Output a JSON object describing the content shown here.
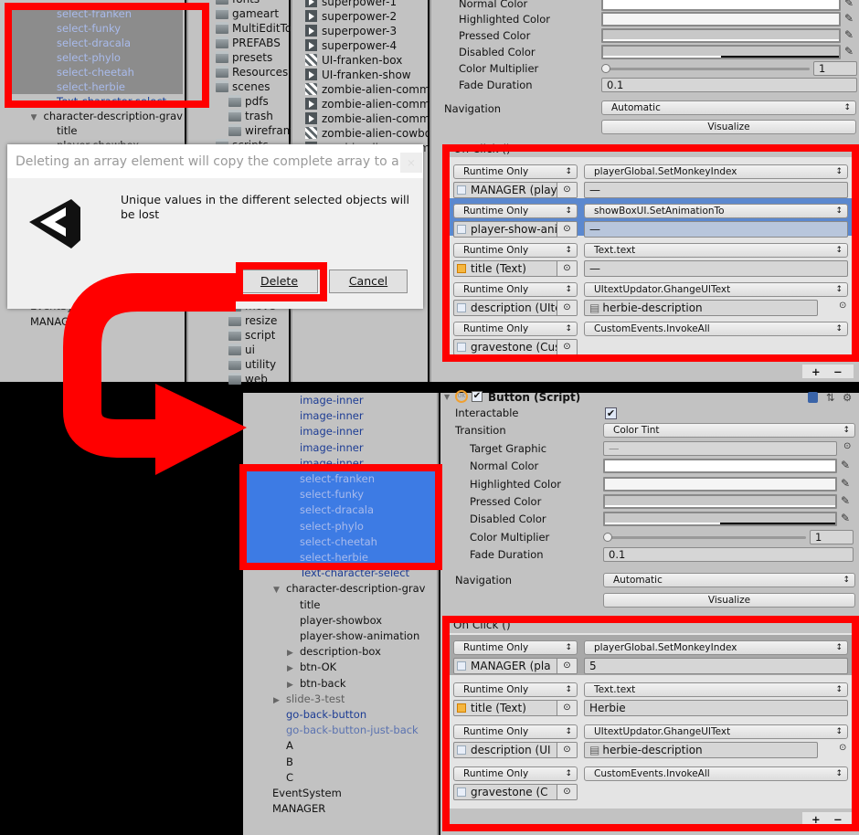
{
  "top": {
    "hierarchy": {
      "items": [
        {
          "label": "select-franken",
          "depth": 2,
          "style": "prefab-sel"
        },
        {
          "label": "select-funky",
          "depth": 2,
          "style": "prefab-sel"
        },
        {
          "label": "select-dracala",
          "depth": 2,
          "style": "prefab-sel"
        },
        {
          "label": "select-phylo",
          "depth": 2,
          "style": "prefab-sel"
        },
        {
          "label": "select-cheetah",
          "depth": 2,
          "style": "prefab-sel"
        },
        {
          "label": "select-herbie",
          "depth": 2,
          "style": "prefab-sel"
        },
        {
          "label": "Text-character-select",
          "depth": 2,
          "style": "prefab"
        },
        {
          "label": "character-description-grav",
          "depth": 1,
          "style": "",
          "arrow": "down"
        },
        {
          "label": "title",
          "depth": 2,
          "style": ""
        },
        {
          "label": "player-showbox",
          "depth": 2,
          "style": ""
        }
      ],
      "after_dialog": [
        {
          "label": "EventSystem",
          "depth": 0,
          "style": ""
        },
        {
          "label": "MANAGER",
          "depth": 0,
          "style": ""
        }
      ]
    },
    "folders": [
      {
        "label": "fonts",
        "indent": 0
      },
      {
        "label": "gameart",
        "indent": 0,
        "arrow": "right"
      },
      {
        "label": "MultiEditTo",
        "indent": 0,
        "arrow": "right"
      },
      {
        "label": "PREFABS",
        "indent": 0,
        "arrow": "right"
      },
      {
        "label": "presets",
        "indent": 0
      },
      {
        "label": "Resources",
        "indent": 0
      },
      {
        "label": "scenes",
        "indent": 0,
        "arrow": "down"
      },
      {
        "label": "pdfs",
        "indent": 1
      },
      {
        "label": "trash",
        "indent": 1
      },
      {
        "label": "wirefram",
        "indent": 1
      },
      {
        "label": "scripts",
        "indent": 0,
        "arrow": "down"
      }
    ],
    "folders_lower": [
      {
        "label": "move",
        "indent": 1
      },
      {
        "label": "resize",
        "indent": 1
      },
      {
        "label": "script",
        "indent": 1
      },
      {
        "label": "ui",
        "indent": 1
      },
      {
        "label": "utility",
        "indent": 1
      },
      {
        "label": "web",
        "indent": 1
      }
    ],
    "files": [
      {
        "label": "superpower-1",
        "icon": "play"
      },
      {
        "label": "superpower-2",
        "icon": "play"
      },
      {
        "label": "superpower-3",
        "icon": "play"
      },
      {
        "label": "superpower-4",
        "icon": "play"
      },
      {
        "label": "UI-franken-box",
        "icon": "grid"
      },
      {
        "label": "UI-franken-show",
        "icon": "play"
      },
      {
        "label": "zombie-alien-comma",
        "icon": "grid"
      },
      {
        "label": "zombie-alien-comma",
        "icon": "play"
      },
      {
        "label": "zombie-alien-comma",
        "icon": "play"
      },
      {
        "label": "zombie-alien-cowbo",
        "icon": "grid"
      },
      {
        "label": "zombie-alien-comma",
        "icon": "play"
      }
    ],
    "inspector": {
      "normal_color": "Normal Color",
      "highlighted_color": "Highlighted Color",
      "pressed_color": "Pressed Color",
      "disabled_color": "Disabled Color",
      "color_multiplier": "Color Multiplier",
      "color_multiplier_value": "1",
      "fade_duration": "Fade Duration",
      "fade_duration_value": "0.1",
      "navigation": "Navigation",
      "navigation_value": "Automatic",
      "visualize": "Visualize",
      "on_click": "On Click ()",
      "entries": [
        {
          "mode": "Runtime Only",
          "function": "playerGlobal.SetMonkeyIndex",
          "object": "MANAGER (playe",
          "obj_icon": "script",
          "arg": "—"
        },
        {
          "mode": "Runtime Only",
          "function": "showBoxUI.SetAnimationTo",
          "object": "player-show-anim",
          "obj_icon": "script",
          "arg": "—",
          "selected": true
        },
        {
          "mode": "Runtime Only",
          "function": "Text.text",
          "object": "title (Text)",
          "obj_icon": "text",
          "arg": "—"
        },
        {
          "mode": "Runtime Only",
          "function": "UItextUpdator.GhangeUIText",
          "object": "description (UIte",
          "obj_icon": "script",
          "arg": "herbie-description",
          "arg_is_object": true
        },
        {
          "mode": "Runtime Only",
          "function": "CustomEvents.InvokeAll",
          "object": "gravestone (Cus",
          "obj_icon": "script"
        }
      ],
      "plus": "+",
      "minus": "−"
    },
    "dialog": {
      "title": "Deleting an array element will copy the complete array to all ...",
      "close": "×",
      "message": "Unique values in the different selected objects will be lost",
      "delete": "Delete",
      "cancel": "Cancel"
    }
  },
  "bottom": {
    "hierarchy": {
      "items": [
        {
          "label": "image-inner",
          "depth": 2,
          "style": "prefab"
        },
        {
          "label": "image-inner",
          "depth": 2,
          "style": "prefab"
        },
        {
          "label": "image-inner",
          "depth": 2,
          "style": "prefab"
        },
        {
          "label": "image-inner",
          "depth": 2,
          "style": "prefab"
        },
        {
          "label": "image-inner",
          "depth": 2,
          "style": "prefab"
        },
        {
          "label": "select-franken",
          "depth": 2,
          "style": "prefab-sel",
          "selected": true
        },
        {
          "label": "select-funky",
          "depth": 2,
          "style": "prefab-sel",
          "selected": true
        },
        {
          "label": "select-dracala",
          "depth": 2,
          "style": "prefab-sel",
          "selected": true
        },
        {
          "label": "select-phylo",
          "depth": 2,
          "style": "prefab-sel",
          "selected": true
        },
        {
          "label": "select-cheetah",
          "depth": 2,
          "style": "prefab-sel",
          "selected": true
        },
        {
          "label": "select-herbie",
          "depth": 2,
          "style": "prefab-sel",
          "selected": true
        },
        {
          "label": "Text-character-select",
          "depth": 2,
          "style": "prefab"
        },
        {
          "label": "character-description-grav",
          "depth": 1,
          "style": "",
          "arrow": "down"
        },
        {
          "label": "title",
          "depth": 2,
          "style": ""
        },
        {
          "label": "player-showbox",
          "depth": 2,
          "style": ""
        },
        {
          "label": "player-show-animation",
          "depth": 2,
          "style": ""
        },
        {
          "label": "description-box",
          "depth": 2,
          "style": "",
          "arrow": "right"
        },
        {
          "label": "btn-OK",
          "depth": 2,
          "style": "",
          "arrow": "right"
        },
        {
          "label": "btn-back",
          "depth": 2,
          "style": "",
          "arrow": "right"
        },
        {
          "label": "slide-3-test",
          "depth": 1,
          "style": "disabled",
          "arrow": "right"
        },
        {
          "label": "go-back-button",
          "depth": 1,
          "style": "prefab"
        },
        {
          "label": "go-back-button-just-back",
          "depth": 1,
          "style": "prefab-dim"
        },
        {
          "label": "A",
          "depth": 1,
          "style": ""
        },
        {
          "label": "B",
          "depth": 1,
          "style": ""
        },
        {
          "label": "C",
          "depth": 1,
          "style": ""
        },
        {
          "label": "EventSystem",
          "depth": 0,
          "style": ""
        },
        {
          "label": "MANAGER",
          "depth": 0,
          "style": ""
        }
      ]
    },
    "inspector": {
      "component_title": "Button (Script)",
      "component_icon_text": "OK",
      "interactable": "Interactable",
      "interactable_checked": true,
      "transition": "Transition",
      "transition_value": "Color Tint",
      "target_graphic": "Target Graphic",
      "target_graphic_value": "—",
      "normal_color": "Normal Color",
      "highlighted_color": "Highlighted Color",
      "pressed_color": "Pressed Color",
      "disabled_color": "Disabled Color",
      "color_multiplier": "Color Multiplier",
      "color_multiplier_value": "1",
      "fade_duration": "Fade Duration",
      "fade_duration_value": "0.1",
      "navigation": "Navigation",
      "navigation_value": "Automatic",
      "visualize": "Visualize",
      "on_click": "On Click ()",
      "entries": [
        {
          "mode": "Runtime Only",
          "function": "playerGlobal.SetMonkeyIndex",
          "object": "MANAGER (pla",
          "obj_icon": "script",
          "arg": "5",
          "selected": true
        },
        {
          "mode": "Runtime Only",
          "function": "Text.text",
          "object": "title (Text)",
          "obj_icon": "text",
          "arg": "Herbie"
        },
        {
          "mode": "Runtime Only",
          "function": "UItextUpdator.GhangeUIText",
          "object": "description (UI",
          "obj_icon": "script",
          "arg": "herbie-description",
          "arg_is_object": true
        },
        {
          "mode": "Runtime Only",
          "function": "CustomEvents.InvokeAll",
          "object": "gravestone (C",
          "obj_icon": "script"
        }
      ],
      "plus": "+",
      "minus": "−"
    }
  },
  "colors": {
    "highlight": "#f00000",
    "selection": "#3d7be4",
    "panel": "#c2c2c2"
  }
}
